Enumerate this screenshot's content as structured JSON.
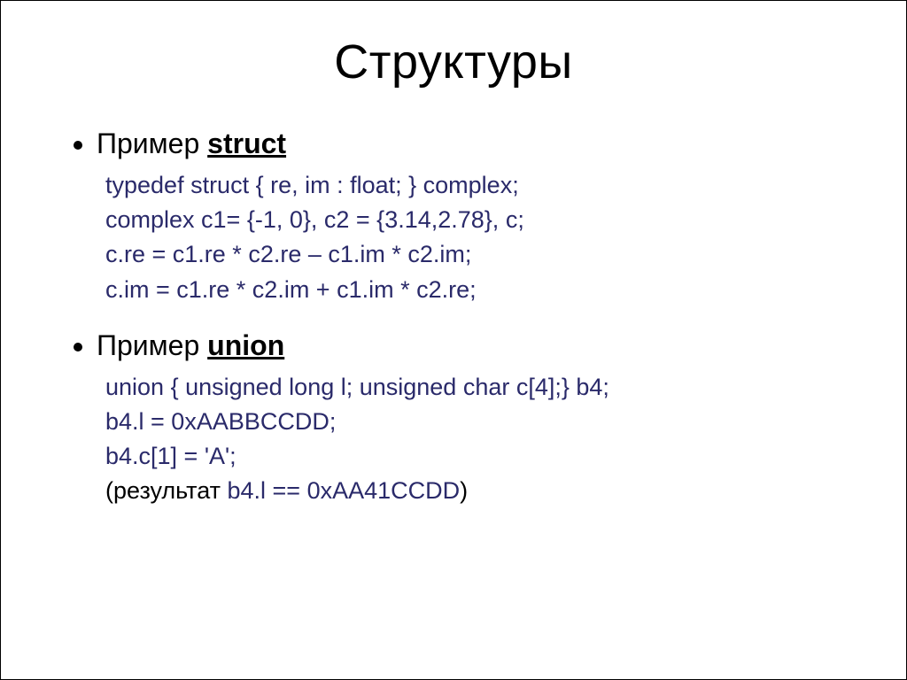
{
  "title": "Структуры",
  "section1": {
    "label_prefix": "Пример ",
    "label_keyword": "struct",
    "code": {
      "l1": "typedef struct { re, im : float; } complex;",
      "l2": "complex c1= {-1, 0}, c2 = {3.14,2.78}, c;",
      "l3": "c.re = c1.re * c2.re – c1.im * c2.im;",
      "l4": "c.im = c1.re * c2.im + c1.im * c2.re;"
    }
  },
  "section2": {
    "label_prefix": "Пример ",
    "label_keyword": "union",
    "code": {
      "l1": "union { unsigned long l; unsigned char c[4];} b4;",
      "l2": "b4.l = 0xAABBCCDD;",
      "l3": "b4.c[1] = 'A';",
      "l4_prefix": "(",
      "l4_label": "результат",
      "l4_value": "  b4.l == 0xAA41CCDD",
      "l4_suffix": ")"
    }
  }
}
